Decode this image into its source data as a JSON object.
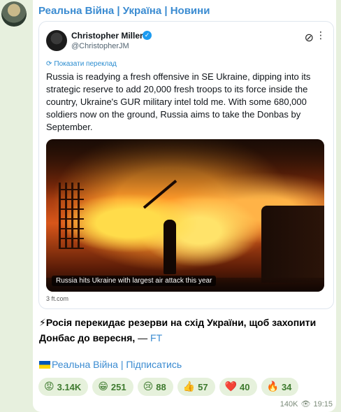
{
  "channel": {
    "name": "Реальна Війна | Україна | Новини"
  },
  "tweet": {
    "author_name": "Christopher Miller",
    "author_handle": "@ChristopherJM",
    "translate_label": "Показати переклад",
    "text": "Russia is readying a fresh offensive in SE Ukraine, dipping into its strategic reserve to add 20,000 fresh troops to its force inside the country, Ukraine's GUR military intel told me. With some 680,000 soldiers now on the ground, Russia aims to take the Donbas by September.",
    "image_caption": "Russia hits Ukraine with largest air attack this year",
    "source": "3 ft.com"
  },
  "message": {
    "lead_emoji": "⚡",
    "text": "Росія перекидає резерви на схід України, щоб захопити Донбас до вересня,",
    "dash": " — ",
    "link": "FT"
  },
  "subscribe": {
    "label": "Реальна Війна | Підписатись"
  },
  "reactions": [
    {
      "emoji": "😡",
      "icon": "angry-face-icon",
      "count": "3.14K"
    },
    {
      "emoji": "😁",
      "icon": "grinning-face-icon",
      "count": "251"
    },
    {
      "emoji": "😢",
      "icon": "crying-face-icon",
      "count": "88"
    },
    {
      "emoji": "👍",
      "icon": "thumbs-up-icon",
      "count": "57"
    },
    {
      "emoji": "❤️",
      "icon": "heart-icon",
      "count": "40"
    },
    {
      "emoji": "🔥",
      "icon": "fire-icon",
      "count": "34"
    }
  ],
  "meta": {
    "views": "140K",
    "time": "19:15"
  },
  "colors": {
    "link": "#3a8bd1",
    "bg": "#e7f0de",
    "reaction_bg": "#e6f1dc"
  }
}
